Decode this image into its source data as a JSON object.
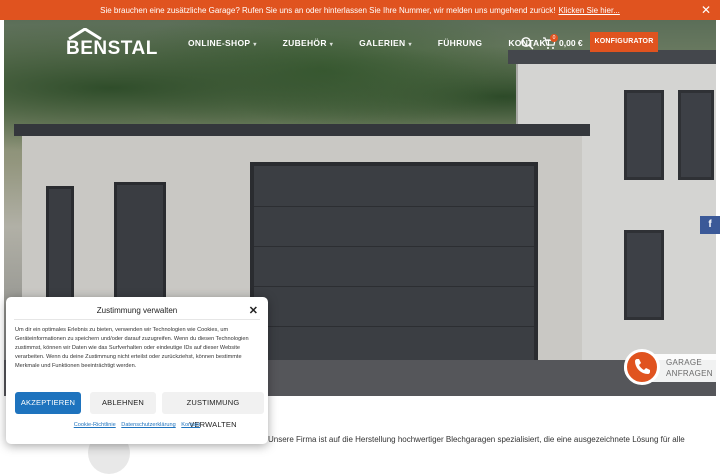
{
  "colors": {
    "accent": "#e0531f",
    "consent_primary": "#1e73be",
    "facebook": "#3b5998"
  },
  "announcement": {
    "text": "Sie brauchen eine zusätzliche Garage? Rufen Sie uns an oder hinterlassen Sie Ihre Nummer, wir melden uns umgehend zurück!",
    "link_label": "Klicken Sie hier...",
    "close_icon": "close-icon"
  },
  "header": {
    "logo_text": "BENSTAL",
    "nav": [
      {
        "label": "ONLINE-SHOP",
        "has_dropdown": true
      },
      {
        "label": "ZUBEHÖR",
        "has_dropdown": true
      },
      {
        "label": "GALERIEN",
        "has_dropdown": true
      },
      {
        "label": "FÜHRUNG",
        "has_dropdown": false
      },
      {
        "label": "KONTAKT",
        "has_dropdown": false
      }
    ],
    "search_icon": "search-icon",
    "cart_icon": "cart-icon",
    "cart_count": "0",
    "cart_total": "0,00 €",
    "configurator_label": "KONFIGURATOR"
  },
  "social": {
    "facebook_label": "f"
  },
  "inquiry": {
    "line1": "GARAGE",
    "line2": "ANFRAGEN",
    "icon": "phone-icon"
  },
  "content": {
    "intro": "Unsere Firma ist auf die Herstellung hochwertiger Blechgaragen spezialisiert, die eine ausgezeichnete Lösung für alle"
  },
  "consent": {
    "title": "Zustimmung verwalten",
    "body": "Um dir ein optimales Erlebnis zu bieten, verwenden wir Technologien wie Cookies, um Geräteinformationen zu speichern und/oder darauf zuzugreifen. Wenn du diesen Technologien zustimmst, können wir Daten wie das Surfverhalten oder eindeutige IDs auf dieser Website verarbeiten. Wenn du deine Zustimmung nicht erteilst oder zurückziehst, können bestimmte Merkmale und Funktionen beeinträchtigt werden.",
    "accept_label": "AKZEPTIEREN",
    "deny_label": "ABLEHNEN",
    "prefs_label": "ZUSTIMMUNG VERWALTEN",
    "links": [
      "Cookie-Richtlinie",
      "Datenschutzerklärung",
      "Kontakt"
    ]
  }
}
